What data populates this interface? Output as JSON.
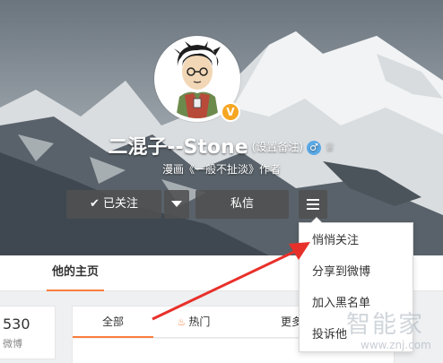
{
  "profile": {
    "username": "二混子--Stone",
    "remark_link": "(设置备注)",
    "gender_icon": "male-icon",
    "member_icon": "crown-icon",
    "description": "漫画《一般不扯淡》作者",
    "verified_badge": "V"
  },
  "actions": {
    "follow_label": "已关注",
    "message_label": "私信"
  },
  "nav": {
    "home_tab": "他的主页"
  },
  "stats": {
    "count": "530",
    "label": "微博"
  },
  "feed_tabs": {
    "all": "全部",
    "hot": "热门",
    "more": "更多"
  },
  "menu": {
    "items": [
      "悄悄关注",
      "分享到微博",
      "加入黑名单",
      "投诉他"
    ]
  },
  "watermark": {
    "text": "智能家",
    "url": "www.znj.com"
  },
  "colors": {
    "accent": "#fa7d3c",
    "arrow": "#e8302a",
    "button_bg": "#505050"
  }
}
